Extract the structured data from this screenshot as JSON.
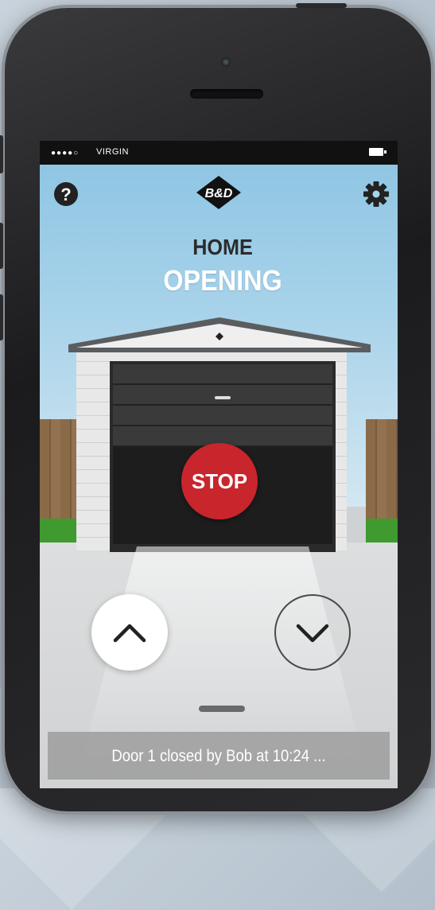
{
  "status_bar": {
    "signal_dots": "●●●●○",
    "carrier": "VIRGIN",
    "battery_icon": "battery-icon"
  },
  "header": {
    "help_label": "?",
    "logo_text": "B&D",
    "settings_icon": "gear-icon"
  },
  "door": {
    "name": "HOME",
    "state": "OPENING"
  },
  "controls": {
    "stop_label": "STOP",
    "up_icon": "chevron-up-icon",
    "down_icon": "chevron-down-icon"
  },
  "activity": {
    "last_event": "Door 1 closed by Bob at 10:24 ..."
  },
  "colors": {
    "stop_red": "#c9252c",
    "sky_blue": "#8fc6e4",
    "grass_green": "#3f9a2f"
  }
}
